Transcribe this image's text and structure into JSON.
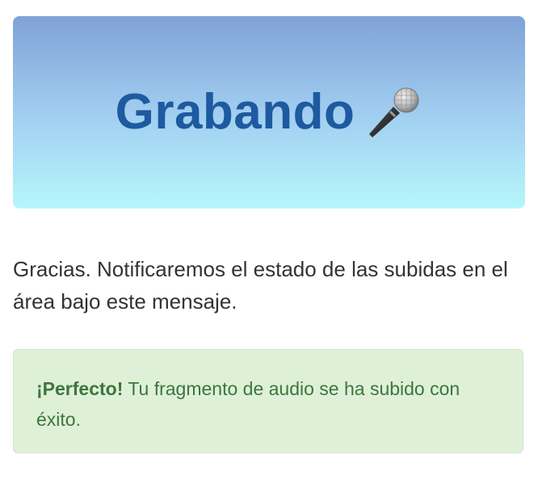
{
  "banner": {
    "title": "Grabando",
    "icon": "microphone-icon"
  },
  "message": {
    "text": "Gracias. Notificaremos el estado de las subidas en el área bajo este mensaje."
  },
  "alert": {
    "type": "success",
    "strong": "¡Perfecto!",
    "text": " Tu fragmento de audio se ha subido con éxito."
  },
  "colors": {
    "title": "#1d5aa0",
    "alert_text": "#3c763d",
    "alert_bg": "#dff0d8"
  }
}
